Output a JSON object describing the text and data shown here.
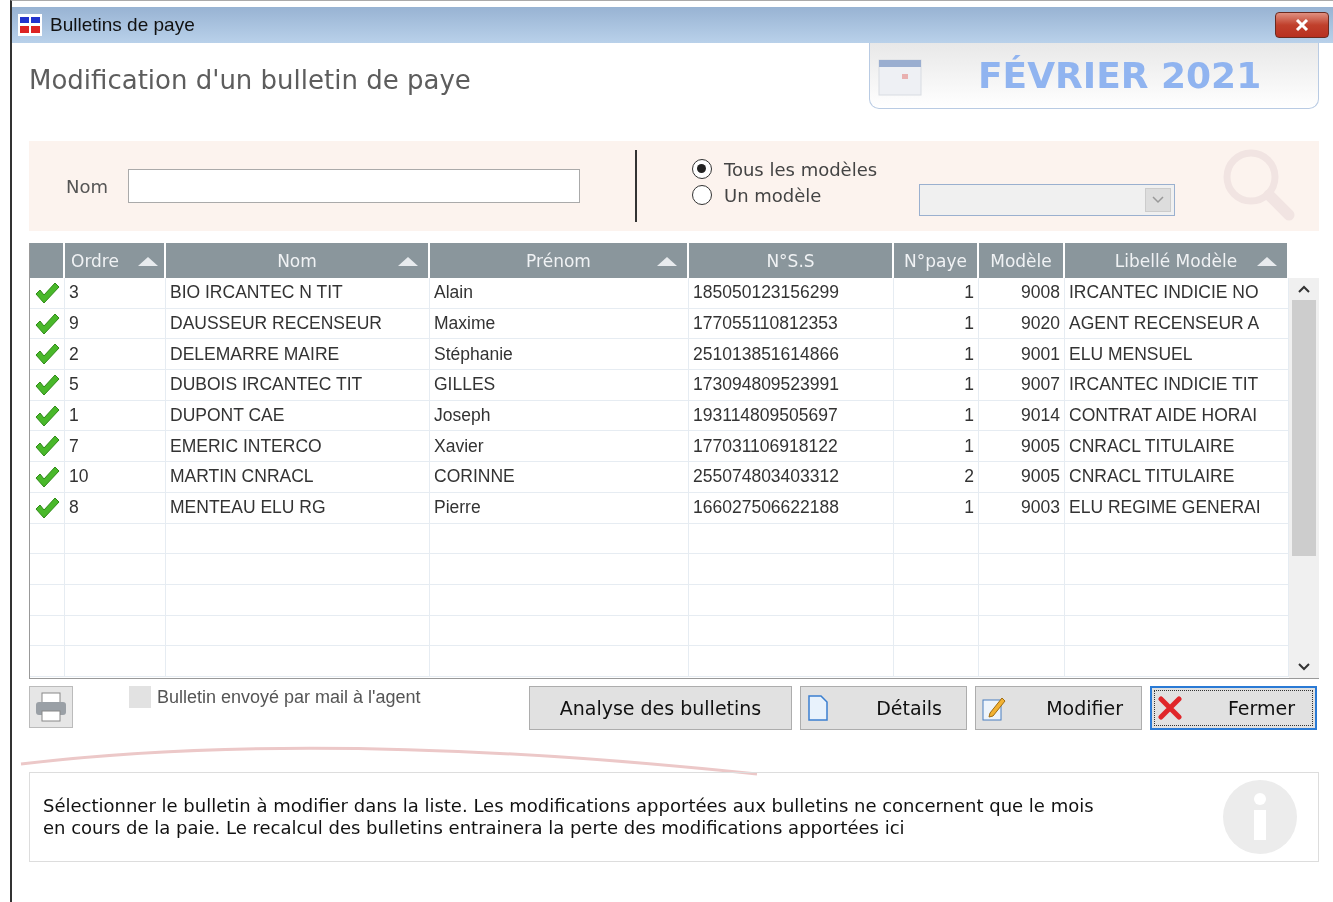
{
  "window": {
    "title": "Bulletins de paye"
  },
  "header": {
    "title": "Modification d'un bulletin de paye",
    "period": "FÉVRIER 2021"
  },
  "filter": {
    "name_label": "Nom",
    "model_options": [
      {
        "label": "Tous les modèles",
        "selected": true
      },
      {
        "label": "Un modèle",
        "selected": false
      }
    ],
    "model_select": {
      "disabled": true
    }
  },
  "table": {
    "columns": [
      {
        "label": "Ordre",
        "kind": "text",
        "sort_arrow": true
      },
      {
        "label": "Nom",
        "kind": "text",
        "sort_arrow": true
      },
      {
        "label": "Prénom",
        "kind": "text",
        "sort_arrow": true
      },
      {
        "label": "N°S.S",
        "kind": "text",
        "sort_arrow": false
      },
      {
        "label": "N°paye",
        "kind": "number",
        "sort_arrow": false
      },
      {
        "label": "Modèle",
        "kind": "number",
        "sort_arrow": false
      },
      {
        "label": "Libellé Modèle",
        "kind": "text",
        "sort_arrow": true
      }
    ],
    "rows": [
      {
        "ok": true,
        "cells": [
          "3",
          "BIO IRCANTEC N TIT",
          "Alain",
          "185050123156299",
          "1",
          "9008",
          "IRCANTEC INDICIE NO"
        ]
      },
      {
        "ok": true,
        "cells": [
          "9",
          "DAUSSEUR RECENSEUR",
          "Maxime",
          "177055110812353",
          "1",
          "9020",
          "AGENT RECENSEUR A"
        ]
      },
      {
        "ok": true,
        "cells": [
          "2",
          "DELEMARRE MAIRE",
          "Stéphanie",
          "251013851614866",
          "1",
          "9001",
          "ELU MENSUEL"
        ]
      },
      {
        "ok": true,
        "cells": [
          "5",
          "DUBOIS IRCANTEC TIT",
          "GILLES",
          "173094809523991",
          "1",
          "9007",
          "IRCANTEC INDICIE TIT"
        ]
      },
      {
        "ok": true,
        "cells": [
          "1",
          "DUPONT CAE",
          "Joseph",
          "193114809505697",
          "1",
          "9014",
          "CONTRAT AIDE HORAI"
        ]
      },
      {
        "ok": true,
        "cells": [
          "7",
          "EMERIC INTERCO",
          "Xavier",
          "177031106918122",
          "1",
          "9005",
          "CNRACL TITULAIRE"
        ]
      },
      {
        "ok": true,
        "cells": [
          "10",
          "MARTIN CNRACL",
          "CORINNE",
          "255074803403312",
          "2",
          "9005",
          "CNRACL TITULAIRE"
        ]
      },
      {
        "ok": true,
        "cells": [
          "8",
          "MENTEAU ELU RG",
          "Pierre",
          "166027506622188",
          "1",
          "9003",
          "ELU REGIME GENERAI"
        ]
      }
    ]
  },
  "mail_option": {
    "label": "Bulletin envoyé par mail à l'agent",
    "checked": false,
    "disabled": true
  },
  "buttons": [
    {
      "label": "Analyse des bulletins",
      "kind": "plain",
      "focused": false
    },
    {
      "label": "Détails",
      "kind": "document",
      "focused": false
    },
    {
      "label": "Modifier",
      "kind": "edit",
      "focused": false
    },
    {
      "label": "Fermer",
      "kind": "close",
      "focused": true
    }
  ],
  "info": {
    "text": "Sélectionner le bulletin à modifier dans la liste. Les modifications apportées aux bulletins ne concernent que le mois en cours de la paie. Le recalcul des bulletins entrainera la perte des modifications apportées ici"
  }
}
